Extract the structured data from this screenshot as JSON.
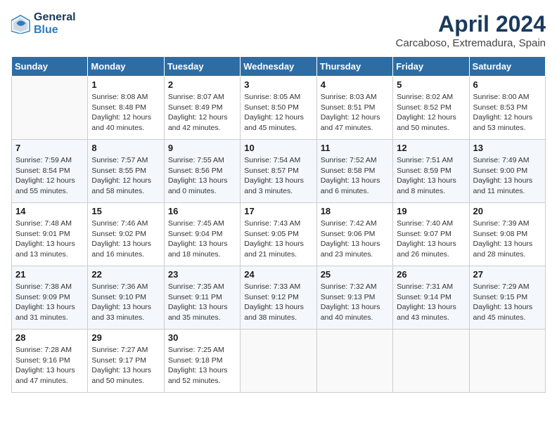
{
  "header": {
    "logo_line1": "General",
    "logo_line2": "Blue",
    "title": "April 2024",
    "subtitle": "Carcaboso, Extremadura, Spain"
  },
  "calendar": {
    "days_of_week": [
      "Sunday",
      "Monday",
      "Tuesday",
      "Wednesday",
      "Thursday",
      "Friday",
      "Saturday"
    ],
    "weeks": [
      [
        {
          "day": "",
          "info": ""
        },
        {
          "day": "1",
          "info": "Sunrise: 8:08 AM\nSunset: 8:48 PM\nDaylight: 12 hours\nand 40 minutes."
        },
        {
          "day": "2",
          "info": "Sunrise: 8:07 AM\nSunset: 8:49 PM\nDaylight: 12 hours\nand 42 minutes."
        },
        {
          "day": "3",
          "info": "Sunrise: 8:05 AM\nSunset: 8:50 PM\nDaylight: 12 hours\nand 45 minutes."
        },
        {
          "day": "4",
          "info": "Sunrise: 8:03 AM\nSunset: 8:51 PM\nDaylight: 12 hours\nand 47 minutes."
        },
        {
          "day": "5",
          "info": "Sunrise: 8:02 AM\nSunset: 8:52 PM\nDaylight: 12 hours\nand 50 minutes."
        },
        {
          "day": "6",
          "info": "Sunrise: 8:00 AM\nSunset: 8:53 PM\nDaylight: 12 hours\nand 53 minutes."
        }
      ],
      [
        {
          "day": "7",
          "info": "Sunrise: 7:59 AM\nSunset: 8:54 PM\nDaylight: 12 hours\nand 55 minutes."
        },
        {
          "day": "8",
          "info": "Sunrise: 7:57 AM\nSunset: 8:55 PM\nDaylight: 12 hours\nand 58 minutes."
        },
        {
          "day": "9",
          "info": "Sunrise: 7:55 AM\nSunset: 8:56 PM\nDaylight: 13 hours\nand 0 minutes."
        },
        {
          "day": "10",
          "info": "Sunrise: 7:54 AM\nSunset: 8:57 PM\nDaylight: 13 hours\nand 3 minutes."
        },
        {
          "day": "11",
          "info": "Sunrise: 7:52 AM\nSunset: 8:58 PM\nDaylight: 13 hours\nand 6 minutes."
        },
        {
          "day": "12",
          "info": "Sunrise: 7:51 AM\nSunset: 8:59 PM\nDaylight: 13 hours\nand 8 minutes."
        },
        {
          "day": "13",
          "info": "Sunrise: 7:49 AM\nSunset: 9:00 PM\nDaylight: 13 hours\nand 11 minutes."
        }
      ],
      [
        {
          "day": "14",
          "info": "Sunrise: 7:48 AM\nSunset: 9:01 PM\nDaylight: 13 hours\nand 13 minutes."
        },
        {
          "day": "15",
          "info": "Sunrise: 7:46 AM\nSunset: 9:02 PM\nDaylight: 13 hours\nand 16 minutes."
        },
        {
          "day": "16",
          "info": "Sunrise: 7:45 AM\nSunset: 9:04 PM\nDaylight: 13 hours\nand 18 minutes."
        },
        {
          "day": "17",
          "info": "Sunrise: 7:43 AM\nSunset: 9:05 PM\nDaylight: 13 hours\nand 21 minutes."
        },
        {
          "day": "18",
          "info": "Sunrise: 7:42 AM\nSunset: 9:06 PM\nDaylight: 13 hours\nand 23 minutes."
        },
        {
          "day": "19",
          "info": "Sunrise: 7:40 AM\nSunset: 9:07 PM\nDaylight: 13 hours\nand 26 minutes."
        },
        {
          "day": "20",
          "info": "Sunrise: 7:39 AM\nSunset: 9:08 PM\nDaylight: 13 hours\nand 28 minutes."
        }
      ],
      [
        {
          "day": "21",
          "info": "Sunrise: 7:38 AM\nSunset: 9:09 PM\nDaylight: 13 hours\nand 31 minutes."
        },
        {
          "day": "22",
          "info": "Sunrise: 7:36 AM\nSunset: 9:10 PM\nDaylight: 13 hours\nand 33 minutes."
        },
        {
          "day": "23",
          "info": "Sunrise: 7:35 AM\nSunset: 9:11 PM\nDaylight: 13 hours\nand 35 minutes."
        },
        {
          "day": "24",
          "info": "Sunrise: 7:33 AM\nSunset: 9:12 PM\nDaylight: 13 hours\nand 38 minutes."
        },
        {
          "day": "25",
          "info": "Sunrise: 7:32 AM\nSunset: 9:13 PM\nDaylight: 13 hours\nand 40 minutes."
        },
        {
          "day": "26",
          "info": "Sunrise: 7:31 AM\nSunset: 9:14 PM\nDaylight: 13 hours\nand 43 minutes."
        },
        {
          "day": "27",
          "info": "Sunrise: 7:29 AM\nSunset: 9:15 PM\nDaylight: 13 hours\nand 45 minutes."
        }
      ],
      [
        {
          "day": "28",
          "info": "Sunrise: 7:28 AM\nSunset: 9:16 PM\nDaylight: 13 hours\nand 47 minutes."
        },
        {
          "day": "29",
          "info": "Sunrise: 7:27 AM\nSunset: 9:17 PM\nDaylight: 13 hours\nand 50 minutes."
        },
        {
          "day": "30",
          "info": "Sunrise: 7:25 AM\nSunset: 9:18 PM\nDaylight: 13 hours\nand 52 minutes."
        },
        {
          "day": "",
          "info": ""
        },
        {
          "day": "",
          "info": ""
        },
        {
          "day": "",
          "info": ""
        },
        {
          "day": "",
          "info": ""
        }
      ]
    ]
  }
}
